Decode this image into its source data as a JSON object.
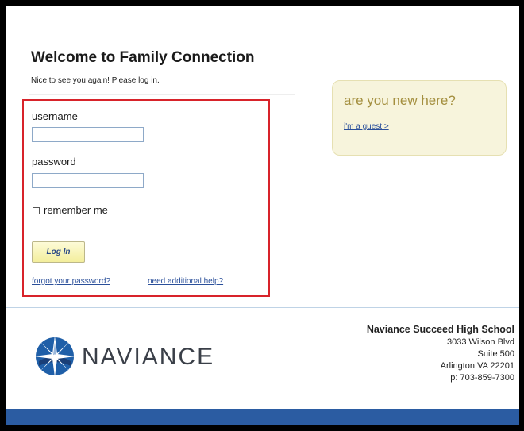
{
  "header": {
    "title": "Welcome to Family Connection",
    "subtitle": "Nice to see you again! Please log in."
  },
  "login": {
    "username_label": "username",
    "username_value": "",
    "password_label": "password",
    "password_value": "",
    "remember_label": "remember me",
    "login_button": "Log In",
    "forgot_link": "forgot your password?",
    "help_link": "need additional help?"
  },
  "new_user": {
    "title": "are you new here?",
    "guest_link": "i'm a guest >"
  },
  "footer": {
    "brand": "NAVIANCE",
    "school_name": "Naviance Succeed High School",
    "address_line1": "3033 Wilson Blvd",
    "address_line2": "Suite 500",
    "address_line3": "Arlington VA 22201",
    "phone": "p: 703-859-7300"
  },
  "colors": {
    "highlight_border": "#d8232a",
    "link": "#2a4f9a",
    "accent_bar": "#2b5ca2",
    "new_box_bg": "#f7f4dc"
  }
}
